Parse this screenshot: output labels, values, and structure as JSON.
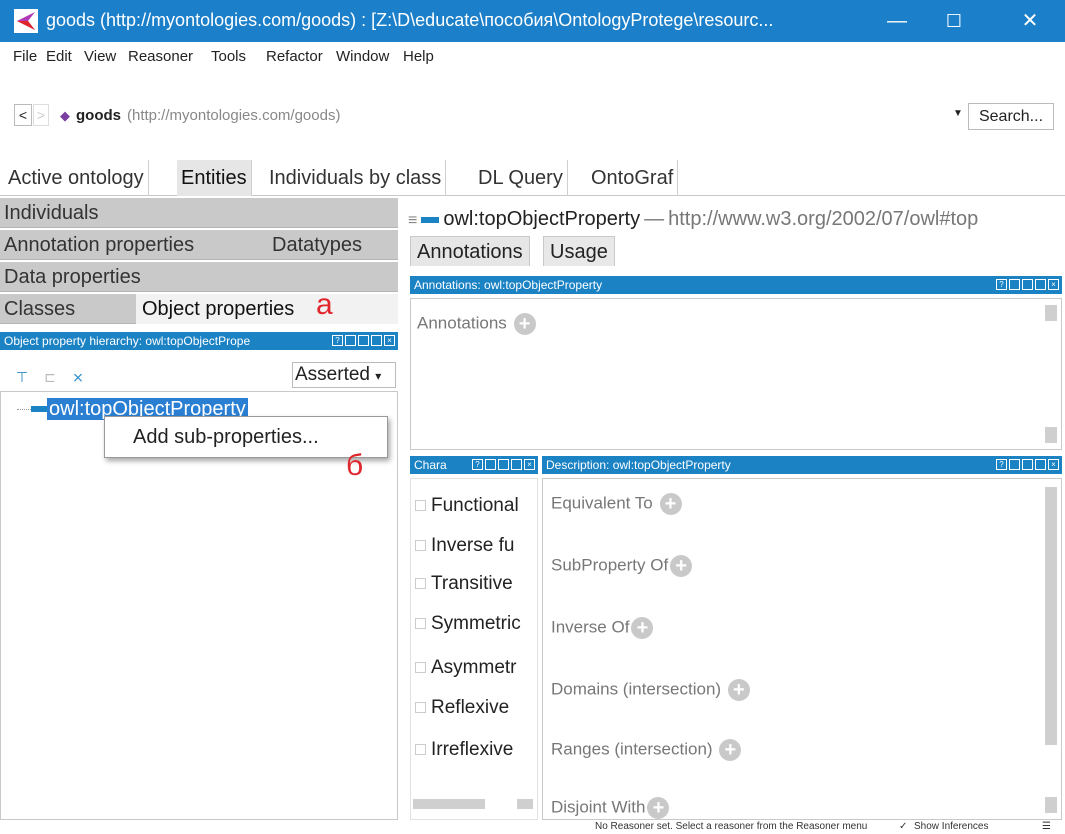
{
  "window": {
    "title": "goods (http://myontologies.com/goods)  : [Z:\\D\\educate\\пособия\\OntologyProtege\\resourc...",
    "minimize": "—",
    "maximize": "☐",
    "close": "✕",
    "titlebar_color": "#1b7fc9"
  },
  "menu": [
    "File",
    "Edit",
    "View",
    "Reasoner",
    "Tools",
    "Refactor",
    "Window",
    "Help"
  ],
  "nav": {
    "back": "<",
    "forward": ">",
    "ontology_name": "goods",
    "ontology_iri": "(http://myontologies.com/goods)",
    "search": "Search..."
  },
  "tabs": [
    "Active ontology",
    "Entities",
    "Individuals by class",
    "DL Query",
    "OntoGraf"
  ],
  "active_tab": "Entities",
  "entity_subtabs": {
    "row1": [
      "Individuals"
    ],
    "row2": [
      "Annotation properties",
      "Datatypes"
    ],
    "row3": [
      "Data properties"
    ],
    "row4": [
      "Classes",
      "Object properties"
    ],
    "active": "Object properties"
  },
  "annotation_marks": {
    "a": "а",
    "b": "б",
    "color": "#e0262d"
  },
  "hierarchy": {
    "header": "Object property hierarchy: owl:topObjectPrope",
    "mode": "Asserted",
    "root": "owl:topObjectProperty",
    "context_menu_item": "Add sub-properties..."
  },
  "entity": {
    "name": "owl:topObjectProperty",
    "dash": "—",
    "iri": "http://www.w3.org/2002/07/owl#top"
  },
  "right_tabs": [
    "Annotations",
    "Usage"
  ],
  "annotations": {
    "header": "Annotations: owl:topObjectProperty",
    "label": "Annotations"
  },
  "characteristics": {
    "header": "Chara",
    "items": [
      "Functional",
      "Inverse fu",
      "Transitive",
      "Symmetric",
      "Asymmetr",
      "Reflexive",
      "Irreflexive"
    ]
  },
  "description": {
    "header": "Description: owl:topObjectProperty",
    "sections": [
      "Equivalent To",
      "SubProperty Of",
      "Inverse Of",
      "Domains (intersection)",
      "Ranges (intersection)",
      "Disjoint With"
    ]
  },
  "status": {
    "text": "No Reasoner set. Select a reasoner from the Reasoner menu",
    "show_inferences": "Show Inferences",
    "checkmark": "✓"
  },
  "accent_color": "#1b82c4"
}
